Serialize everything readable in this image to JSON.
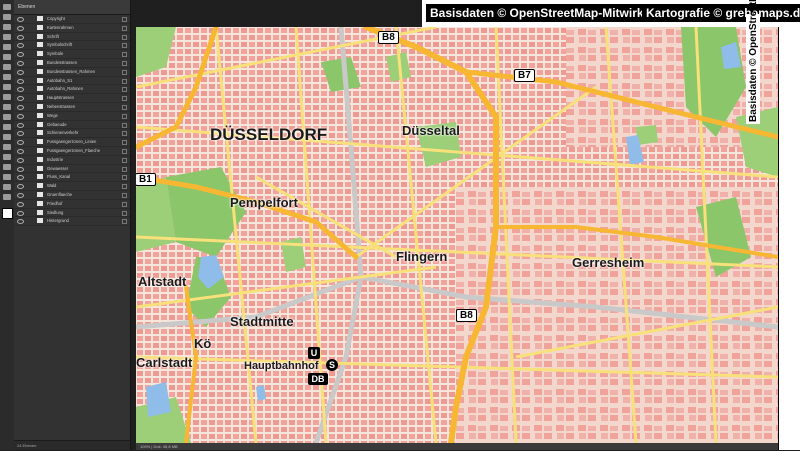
{
  "layers_panel": {
    "title": "Ebenen",
    "layers": [
      "Copyright",
      "Kartenrahmen",
      "Schrift",
      "Symbolschrift",
      "Symbole",
      "Bundesstrassen",
      "Bundesstrassen_Rahmen",
      "Autobahn_S1",
      "Autobahn_Rahmen",
      "Hauptstrassen",
      "Nebenstrassen",
      "Wege",
      "Gebaeude",
      "Schienenverkehr",
      "Fussgaengerzonen_Linien",
      "Fussgaengerzonen_Flaeche",
      "Industrie",
      "Gewaesser",
      "Fluss_Kanal",
      "Wald",
      "Gruenflaeche",
      "Friedhof",
      "Siedlung",
      "Hintergrund"
    ],
    "footer": "24 Ebenen"
  },
  "credits": {
    "basisdaten": "Basisdaten © OpenStreetMap-Mitwirkende",
    "kartografie": "Kartografie © grebemaps.de",
    "vertical": "Basisdaten © OpenStreetMap"
  },
  "map": {
    "districts": {
      "city": "DÜSSELDORF",
      "duesseltal": "Düsseltal",
      "pempelfort": "Pempelfort",
      "flingern": "Flingern",
      "gerresheim": "Gerresheim",
      "altstadt": "Altstadt",
      "stadtmitte": "Stadtmitte",
      "koe": "Kö",
      "carlstadt": "Carlstadt",
      "hauptbahnhof": "Hauptbahnhof"
    },
    "shields": {
      "b8_top": "B8",
      "b7": "B7",
      "b1": "B1",
      "b8_bottom": "B8"
    },
    "symbols": {
      "ubahn": "U",
      "sbahn": "S",
      "db": "DB"
    },
    "colors": {
      "background": "#f6e6dc",
      "building": "#f2a49c",
      "green": "#8cc66a",
      "water": "#8fbce8",
      "major_road": "#f7b733",
      "secondary_road": "#f8e07a"
    }
  },
  "bottom_bar": "100% | Dok: 45,8 MB"
}
